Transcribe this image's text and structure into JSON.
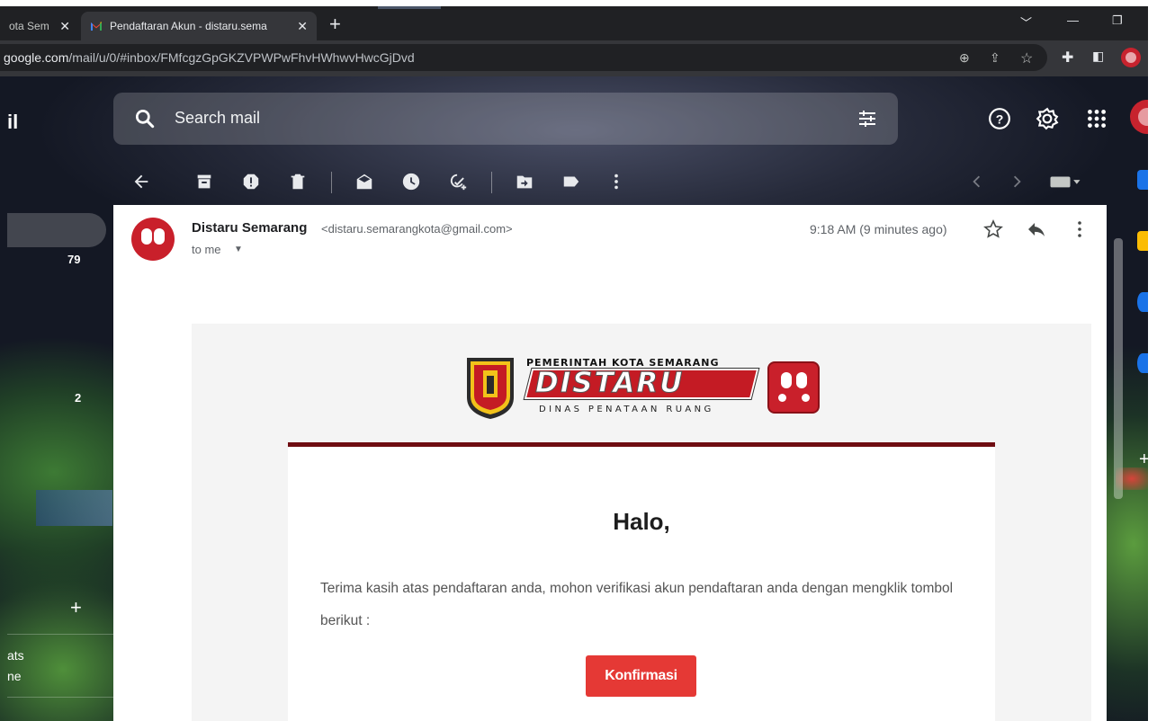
{
  "browser": {
    "tabs": [
      {
        "label": "ota Sem",
        "active": false
      },
      {
        "label": "Pendaftaran Akun - distaru.sema",
        "active": true
      }
    ],
    "new_tab": "+",
    "url_host": "google.com",
    "url_path": "/mail/u/0/#inbox/FMfcgzGpGKZVPWPwFhvHWhwvHwcGjDvd"
  },
  "gmail": {
    "brand_partial": "il",
    "search_placeholder": "Search mail",
    "sidebar": {
      "inbox_count": "79",
      "second_count": "2",
      "add": "+",
      "chats_partial": "ats",
      "line_partial": "ne"
    }
  },
  "message": {
    "sender_name": "Distaru Semarang",
    "sender_email": "<distaru.semarangkota@gmail.com>",
    "to": "to me",
    "time": "9:18 AM (9 minutes ago)",
    "logo": {
      "line1": "PEMERINTAH KOTA SEMARANG",
      "word": "DISTARU",
      "line2": "DINAS PENATAAN RUANG"
    },
    "greeting": "Halo,",
    "body": "Terima kasih atas pendaftaran anda, mohon verifikasi akun pendaftaran anda dengan mengklik tombol berikut :",
    "button": "Konfirmasi"
  },
  "colors": {
    "accent_red": "#e53935",
    "header_bar": "#6f0d12",
    "distaru_red": "#c41b24"
  },
  "icons": {
    "tab_favicon": "gmail-icon",
    "search": "search-icon",
    "filters": "tune-icon",
    "help": "help-icon",
    "settings": "gear-icon",
    "apps": "apps-grid-icon",
    "toolbar": [
      "back-arrow-icon",
      "archive-icon",
      "report-spam-icon",
      "delete-icon",
      "mark-unread-icon",
      "snooze-icon",
      "add-task-icon",
      "move-to-icon",
      "label-icon",
      "more-icon"
    ],
    "message": [
      "star-icon",
      "reply-icon",
      "more-vert-icon"
    ]
  }
}
